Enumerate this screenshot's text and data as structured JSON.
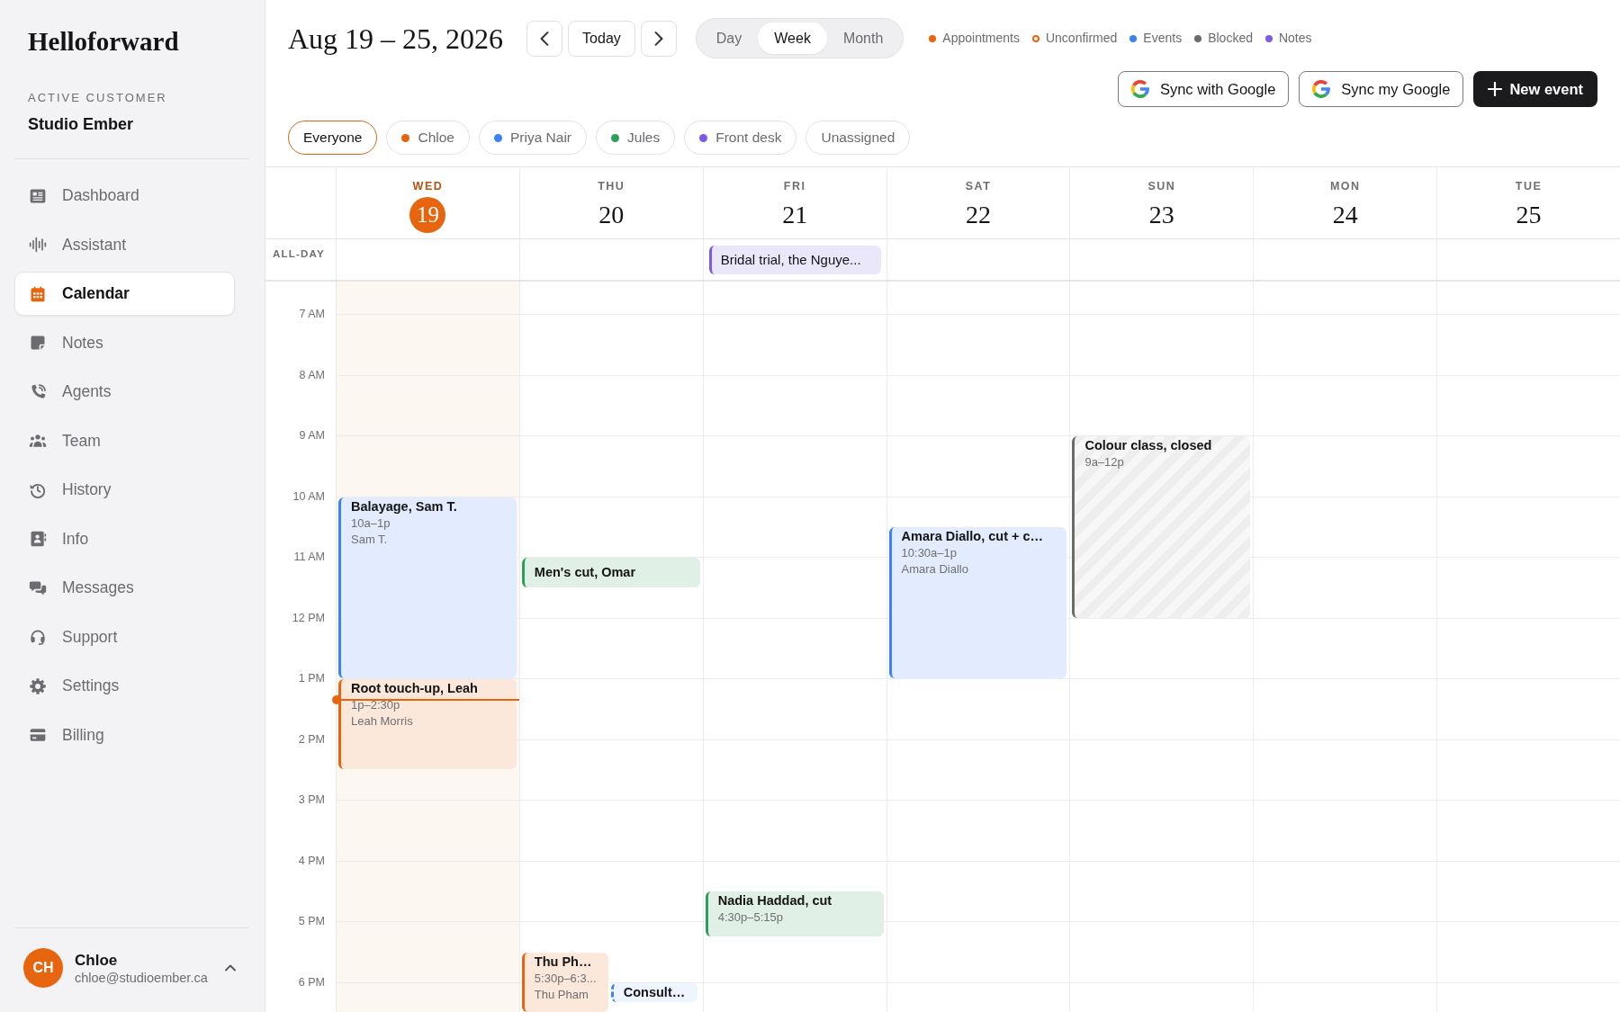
{
  "sidebar": {
    "logo": "Helloforward",
    "customer_label": "ACTIVE CUSTOMER",
    "customer_name": "Studio Ember",
    "items": [
      {
        "label": "Dashboard",
        "selected": false
      },
      {
        "label": "Assistant",
        "selected": false
      },
      {
        "label": "Calendar",
        "selected": true
      },
      {
        "label": "Notes",
        "selected": false
      },
      {
        "label": "Agents",
        "selected": false
      },
      {
        "label": "Team",
        "selected": false
      },
      {
        "label": "History",
        "selected": false
      },
      {
        "label": "Info",
        "selected": false
      },
      {
        "label": "Messages",
        "selected": false
      },
      {
        "label": "Support",
        "selected": false
      },
      {
        "label": "Settings",
        "selected": false
      },
      {
        "label": "Billing",
        "selected": false
      }
    ],
    "user": {
      "initials": "CH",
      "name": "Chloe",
      "email": "chloe@studioember.ca"
    }
  },
  "header": {
    "title": "Aug 19 – 25, 2026",
    "today_label": "Today",
    "views": [
      {
        "label": "Day",
        "selected": false
      },
      {
        "label": "Week",
        "selected": true
      },
      {
        "label": "Month",
        "selected": false
      }
    ],
    "legend": [
      {
        "label": "Appointments",
        "color": "#e8650f",
        "kind": "filled"
      },
      {
        "label": "Unconfirmed",
        "color": "#e8650f",
        "kind": "ring"
      },
      {
        "label": "Events",
        "color": "#3b82f6",
        "kind": "filled"
      },
      {
        "label": "Blocked",
        "color": "#6b6b6b",
        "kind": "filled"
      },
      {
        "label": "Notes",
        "color": "#7c5ce6",
        "kind": "filled"
      }
    ],
    "actions": [
      {
        "label": "Sync with Google",
        "kind": "google"
      },
      {
        "label": "Sync my Google",
        "kind": "google"
      },
      {
        "label": "New event",
        "kind": "primary"
      }
    ]
  },
  "filters": [
    {
      "label": "Everyone",
      "selected": true
    },
    {
      "label": "Chloe",
      "selected": false,
      "color": "#e8650f"
    },
    {
      "label": "Priya Nair",
      "selected": false,
      "color": "#3b82f6"
    },
    {
      "label": "Jules",
      "selected": false,
      "color": "#2e9e5b"
    },
    {
      "label": "Front desk",
      "selected": false,
      "color": "#7c5ce6"
    },
    {
      "label": "Unassigned",
      "selected": false
    }
  ],
  "calendar": {
    "all_day_label": "ALL-DAY",
    "hours": [
      "7 AM",
      "8 AM",
      "9 AM",
      "10 AM",
      "11 AM",
      "12 PM",
      "1 PM",
      "2 PM",
      "3 PM",
      "4 PM",
      "5 PM",
      "6 PM"
    ],
    "days": [
      {
        "weekday": "WED",
        "date": "19",
        "today": true,
        "events": [
          {
            "title": "Balayage, Sam T.",
            "time": "10a–1p",
            "client": "Sam T.",
            "color": "#3b82f6",
            "kind": "appointment"
          },
          {
            "title": "Root touch-up, Leah",
            "time": "1p–2:30p",
            "client": "Leah Morris",
            "color": "#e8650f",
            "kind": "appointment"
          }
        ]
      },
      {
        "weekday": "THU",
        "date": "20",
        "today": false,
        "events": [
          {
            "title": "Men's cut, Omar",
            "color": "#2e9e5b",
            "kind": "appointment"
          },
          {
            "title": "Thu Ph…",
            "time": "5:30p–6:3...",
            "client": "Thu Pham",
            "color": "#e8650f",
            "kind": "appointment"
          },
          {
            "title": "Consult…",
            "color": "#3b82f6",
            "kind": "unconfirmed"
          }
        ]
      },
      {
        "weekday": "FRI",
        "date": "21",
        "today": false,
        "all_day": [
          {
            "title": "Bridal trial, the Nguye...",
            "color": "#7c5ce6"
          }
        ],
        "events": [
          {
            "title": "Nadia Haddad, cut",
            "time": "4:30p–5:15p",
            "color": "#2e9e5b",
            "kind": "appointment"
          }
        ]
      },
      {
        "weekday": "SAT",
        "date": "22",
        "today": false,
        "events": [
          {
            "title": "Amara Diallo, cut + c…",
            "time": "10:30a–1p",
            "client": "Amara Diallo",
            "color": "#3b82f6",
            "kind": "appointment"
          }
        ]
      },
      {
        "weekday": "SUN",
        "date": "23",
        "today": false,
        "events": [
          {
            "title": "Colour class, closed",
            "time": "9a–12p",
            "color": "#6b6b6b",
            "kind": "blocked"
          }
        ]
      },
      {
        "weekday": "MON",
        "date": "24",
        "today": false
      },
      {
        "weekday": "TUE",
        "date": "25",
        "today": false
      }
    ]
  }
}
